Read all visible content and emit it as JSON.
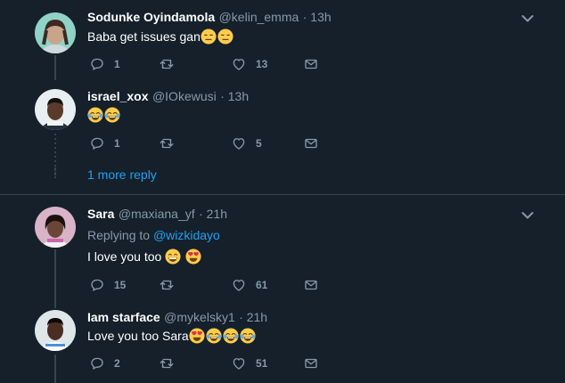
{
  "tweets": [
    {
      "name": "Sodunke Oyindamola",
      "handle": "@kelin_emma",
      "time": "· 13h",
      "text": "Baba get issues gan",
      "emojis": [
        "expressionless",
        "expressionless"
      ],
      "replies": "1",
      "retweets": "",
      "likes": "13"
    },
    {
      "name": "israel_xox",
      "handle": "@IOkewusi",
      "time": "· 13h",
      "text": "",
      "emojis": [
        "joy",
        "joy"
      ],
      "replies": "1",
      "retweets": "",
      "likes": "5"
    },
    {
      "name": "Sara",
      "handle": "@maxiana_yf",
      "time": "· 21h",
      "replying_prefix": "Replying to",
      "replying_handle": "@wizkidayo",
      "text": "I love you too",
      "emojis": [
        "grin",
        "heart-eyes"
      ],
      "replies": "15",
      "retweets": "",
      "likes": "61"
    },
    {
      "name": "Iam starface",
      "handle": "@mykelsky1",
      "time": "· 21h",
      "text": "Love you too Sara",
      "emojis": [
        "heart-eyes",
        "joy",
        "joy",
        "joy"
      ],
      "replies": "2",
      "retweets": "",
      "likes": "51"
    }
  ],
  "more_replies_label": "1 more reply",
  "colors": {
    "background": "#15202b",
    "accent": "#1da1f2",
    "muted": "#8899a6",
    "border": "#38444d"
  },
  "icons": {
    "reply": "reply-icon",
    "retweet": "retweet-icon",
    "like": "heart-icon",
    "dm": "envelope-icon",
    "menu": "chevron-down-icon"
  }
}
